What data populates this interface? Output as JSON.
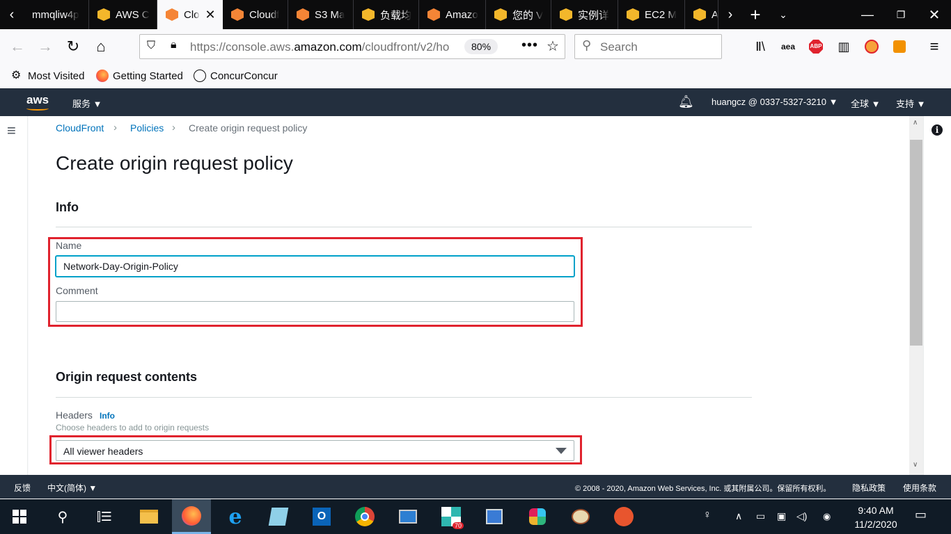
{
  "browser": {
    "tabs": [
      {
        "title": "mmqliw4p",
        "icon": "tab-generic"
      },
      {
        "title": "AWS C",
        "icon": "aws-box-icon"
      },
      {
        "title": "Clo",
        "icon": "cloudfront-icon",
        "active": true
      },
      {
        "title": "Cloudf",
        "icon": "cloudfront-icon"
      },
      {
        "title": "S3 Ma",
        "icon": "cloudfront-icon"
      },
      {
        "title": "负载均",
        "icon": "aws-box-icon"
      },
      {
        "title": "Amazo",
        "icon": "cloudfront-icon"
      },
      {
        "title": "您的 V",
        "icon": "aws-box-icon"
      },
      {
        "title": "实例详",
        "icon": "aws-box-icon"
      },
      {
        "title": "EC2 M",
        "icon": "aws-box-icon"
      },
      {
        "title": "A",
        "icon": "aws-box-icon"
      }
    ],
    "url_prefix": "https://console.aws.",
    "url_domain": "amazon.com",
    "url_suffix": "/cloudfront/v2/ho",
    "zoom": "80%",
    "search_placeholder": "Search",
    "bookmarks": [
      {
        "label": "Most Visited",
        "icon": "gear-icon"
      },
      {
        "label": "Getting Started",
        "icon": "firefox-icon"
      },
      {
        "label": "ConcurConcur",
        "icon": "globe-icon"
      }
    ],
    "toolbar_icons": [
      "library-icon",
      "aea-icon",
      "abp-icon",
      "reader-icon",
      "blocked-icon",
      "extension-icon",
      "menu-icon"
    ]
  },
  "aws": {
    "logo": "aws",
    "services": "服务",
    "account": "huangcz @ 0337-5327-3210",
    "region": "全球",
    "support": "支持",
    "footer": {
      "feedback": "反馈",
      "language": "中文(简体)",
      "copyright": "© 2008 - 2020, Amazon Web Services, Inc. 或其附属公司。保留所有权利。",
      "privacy": "隐私政策",
      "terms": "使用条款"
    }
  },
  "page": {
    "breadcrumb": [
      "CloudFront",
      "Policies",
      "Create origin request policy"
    ],
    "title": "Create origin request policy",
    "info_section": "Info",
    "name_label": "Name",
    "name_value": "Network-Day-Origin-Policy",
    "comment_label": "Comment",
    "comment_value": "",
    "contents_section": "Origin request contents",
    "headers_label": "Headers",
    "headers_info": "Info",
    "headers_hint": "Choose headers to add to origin requests",
    "headers_value": "All viewer headers"
  },
  "taskbar": {
    "time": "9:40 AM",
    "date": "11/2/2020",
    "badge": "70"
  }
}
